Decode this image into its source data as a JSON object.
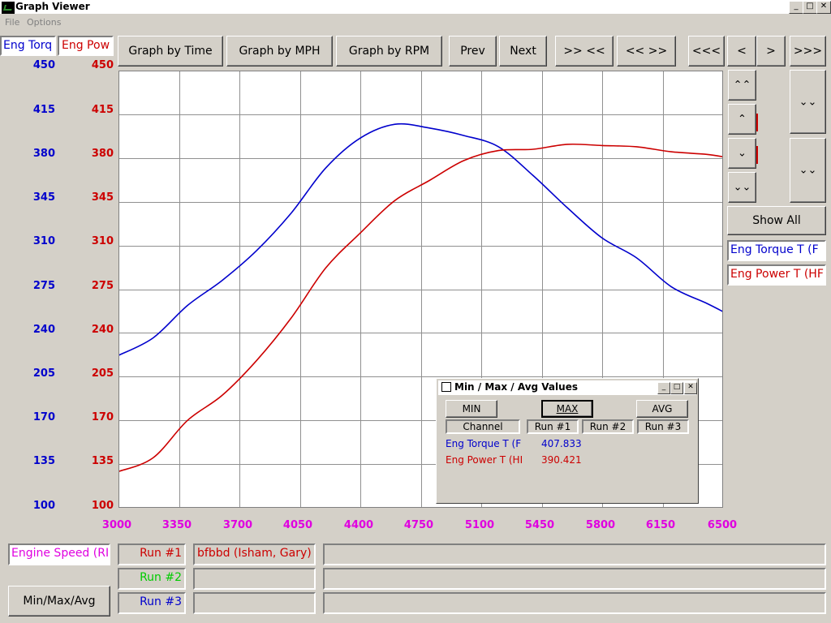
{
  "window": {
    "title": "Graph Viewer"
  },
  "menu": [
    "File",
    "Options"
  ],
  "channel_tabs": {
    "torque": "Eng Torq",
    "power": "Eng Pow"
  },
  "toolbar": {
    "graph_by_time": "Graph by Time",
    "graph_by_mph": "Graph by MPH",
    "graph_by_rpm": "Graph by RPM",
    "prev": "Prev",
    "next": "Next",
    "zoom_in": ">> <<",
    "zoom_out": "<< >>",
    "scroll_far_left": "<<<",
    "scroll_left": "<",
    "scroll_right": ">",
    "scroll_far_right": ">>>"
  },
  "side": {
    "up_fast": "⌃⌃",
    "up": "⌃",
    "down": "⌄",
    "down_fast": "⌄⌄",
    "show_all": "Show All",
    "legend_torque": "Eng Torque T (F",
    "legend_power": "Eng Power T (HF"
  },
  "colors": {
    "torque": "#0000cc",
    "power": "#cc0000",
    "xaxis": "#e000e0",
    "run2": "#00cc00"
  },
  "chart_data": {
    "type": "line",
    "x": [
      3000,
      3200,
      3400,
      3600,
      3800,
      4000,
      4200,
      4400,
      4600,
      4800,
      5000,
      5200,
      5400,
      5600,
      5800,
      6000,
      6200,
      6400,
      6500
    ],
    "series": [
      {
        "name": "Eng Torque T (F",
        "values": [
          222,
          236,
          262,
          282,
          306,
          336,
          372,
          396,
          407,
          404,
          398,
          389,
          366,
          340,
          316,
          300,
          277,
          264,
          257
        ]
      },
      {
        "name": "Eng Power T (HF",
        "values": [
          129,
          140,
          170,
          190,
          218,
          252,
          292,
          320,
          346,
          362,
          378,
          386,
          387,
          391,
          390,
          389,
          385,
          383,
          381
        ]
      }
    ],
    "y_ticks_left": [
      "450",
      "415",
      "380",
      "345",
      "310",
      "275",
      "240",
      "205",
      "170",
      "135",
      "100"
    ],
    "y_ticks_right": [
      "450",
      "415",
      "380",
      "345",
      "310",
      "275",
      "240",
      "205",
      "170",
      "135",
      "100"
    ],
    "x_ticks": [
      "3000",
      "3350",
      "3700",
      "4050",
      "4400",
      "4750",
      "5100",
      "5450",
      "5800",
      "6150",
      "6500"
    ],
    "xlim": [
      3000,
      6500
    ],
    "ylim": [
      100,
      450
    ],
    "grid": true
  },
  "bottom": {
    "x_channel": "Engine Speed (RI",
    "run1": "Run #1",
    "run2": "Run #2",
    "run3": "Run #3",
    "run1_name": "bfbbd (Isham, Gary)",
    "minmax_button": "Min/Max/Avg"
  },
  "dialog": {
    "title": "Min / Max / Avg Values",
    "min": "MIN",
    "max": "MAX",
    "avg": "AVG",
    "col_channel": "Channel",
    "col_run1": "Run #1",
    "col_run2": "Run #2",
    "col_run3": "Run #3",
    "rows": [
      {
        "channel": "Eng Torque T (F",
        "run1": "407.833"
      },
      {
        "channel": "Eng Power T (HI",
        "run1": "390.421"
      }
    ]
  }
}
